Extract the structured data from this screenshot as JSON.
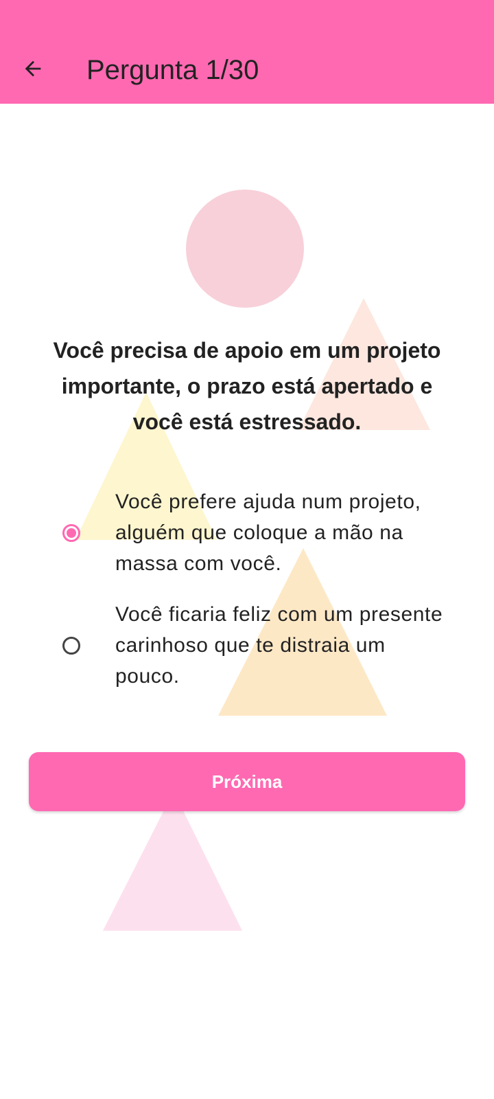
{
  "header": {
    "title": "Pergunta 1/30",
    "back_icon": "arrow-back-icon",
    "background_color": "#ff69b2"
  },
  "question": {
    "text": "Você precisa de apoio em um projeto importante, o prazo está apertado e você está estressado."
  },
  "options": [
    {
      "label": "Você prefere ajuda num projeto, alguém que coloque a mão na massa com você.",
      "selected": true
    },
    {
      "label": "Você ficaria feliz com um presente carinhoso que te distraia um pouco.",
      "selected": false
    }
  ],
  "next_button": {
    "label": "Próxima"
  },
  "colors": {
    "accent": "#ff69b2",
    "circle": "#f8d0da",
    "triangle_peach": "#fde7df",
    "triangle_yellow": "#fdf6cf",
    "triangle_orange": "#fde8c6",
    "triangle_pink": "#fde0ee"
  }
}
